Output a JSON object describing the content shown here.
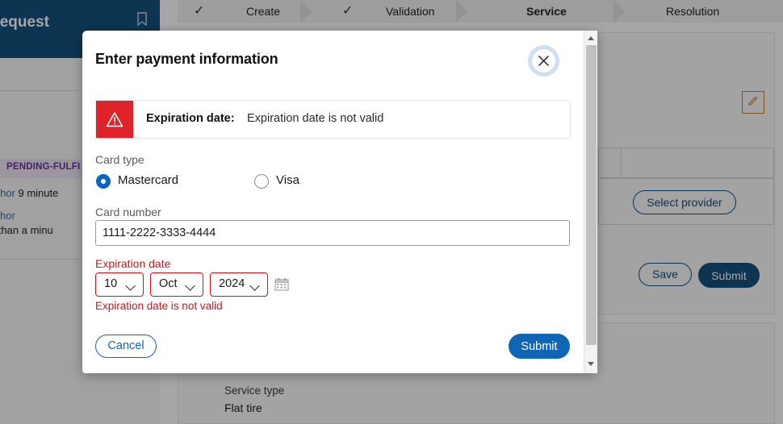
{
  "background": {
    "sidebar": {
      "title": "nce Request",
      "bookmark_icon": "bookmark-icon",
      "status_badge": "PENDING-FULFI",
      "activity": [
        {
          "author": "author",
          "time": "9 minute"
        },
        {
          "author": "author",
          "time": "ess than a minu"
        }
      ]
    },
    "stepper": {
      "steps": [
        {
          "label": "Create",
          "state": "done",
          "check": "✓"
        },
        {
          "label": "Validation",
          "state": "done",
          "check": "✓"
        },
        {
          "label": "Service",
          "state": "active",
          "check": ""
        },
        {
          "label": "Resolution",
          "state": "todo",
          "check": ""
        }
      ]
    },
    "main": {
      "edit_icon": "pencil-icon",
      "select_provider_label": "Select provider",
      "save_label": "Save",
      "submit_label": "Submit",
      "service_type_label": "Service type",
      "service_type_value": "Flat tire"
    }
  },
  "modal": {
    "title": "Enter payment information",
    "close_icon": "close-icon",
    "alert": {
      "icon": "warning-triangle-icon",
      "field": "Expiration date:",
      "message": "Expiration date is not valid"
    },
    "card_type": {
      "label": "Card type",
      "options": [
        {
          "label": "Mastercard",
          "selected": true
        },
        {
          "label": "Visa",
          "selected": false
        }
      ]
    },
    "card_number": {
      "label": "Card number",
      "value": "1111-2222-3333-4444",
      "placeholder": "Card number"
    },
    "expiration": {
      "label": "Expiration date",
      "day": "10",
      "month": "Oct",
      "year": "2024",
      "calendar_icon": "calendar-icon",
      "error": "Expiration date is not valid"
    },
    "footer": {
      "cancel_label": "Cancel",
      "submit_label": "Submit"
    },
    "scrollbar": {
      "up_icon": "scroll-up-arrow-icon",
      "down_icon": "scroll-down-arrow-icon"
    }
  },
  "colors": {
    "brand_blue": "#14507d",
    "accent_blue": "#1066b4",
    "error_red": "#d0131d",
    "alert_red": "#e0222a",
    "badge_purple": "#6b2fa0",
    "edit_orange": "#c87d2a"
  }
}
